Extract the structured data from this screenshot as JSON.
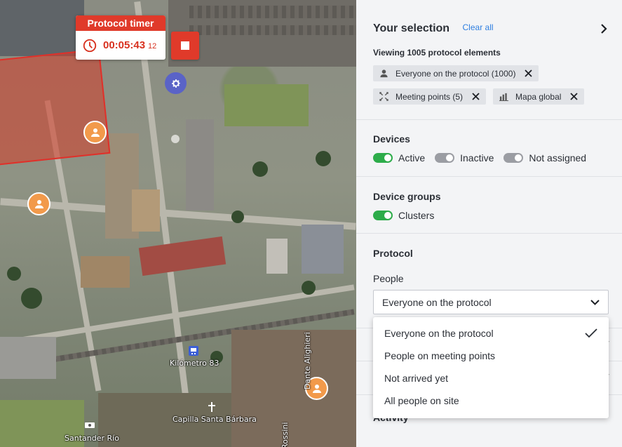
{
  "timer": {
    "title": "Protocol timer",
    "value": "00:05:43",
    "fraction": "12"
  },
  "map_labels": {
    "station": "Kilómetro 83",
    "chapel": "Capilla Santa Bárbara",
    "bank": "Santander Río",
    "street1": "Dante Alighieri",
    "street2": "Rossini"
  },
  "selection": {
    "title": "Your selection",
    "clear_all": "Clear all",
    "viewing": "Viewing 1005 protocol elements",
    "chips": [
      {
        "label": "Everyone on the protocol (1000)",
        "icon": "person-icon"
      },
      {
        "label": "Meeting points (5)",
        "icon": "meeting-point-icon"
      },
      {
        "label": "Mapa global",
        "icon": "bar-chart-icon"
      }
    ]
  },
  "devices": {
    "title": "Devices",
    "toggles": [
      {
        "label": "Active",
        "on": true
      },
      {
        "label": "Inactive",
        "on": false
      },
      {
        "label": "Not assigned",
        "on": false
      }
    ]
  },
  "device_groups": {
    "title": "Device groups",
    "toggles": [
      {
        "label": "Clusters",
        "on": true
      }
    ]
  },
  "protocol": {
    "title": "Protocol",
    "people_label": "People",
    "people_value": "Everyone on the protocol",
    "options": [
      {
        "label": "Everyone on the protocol",
        "selected": true
      },
      {
        "label": "People on meeting points",
        "selected": false
      },
      {
        "label": "Not arrived yet",
        "selected": false
      },
      {
        "label": "All people on site",
        "selected": false
      }
    ]
  },
  "activity": {
    "title": "Activity"
  },
  "colors": {
    "accent_red": "#e03a2a",
    "toggle_on": "#2dac4a",
    "toggle_off": "#9b9da3",
    "link_blue": "#2f7fe0",
    "person_pin": "#f29a4b",
    "gear_pin": "#5a63c7"
  }
}
